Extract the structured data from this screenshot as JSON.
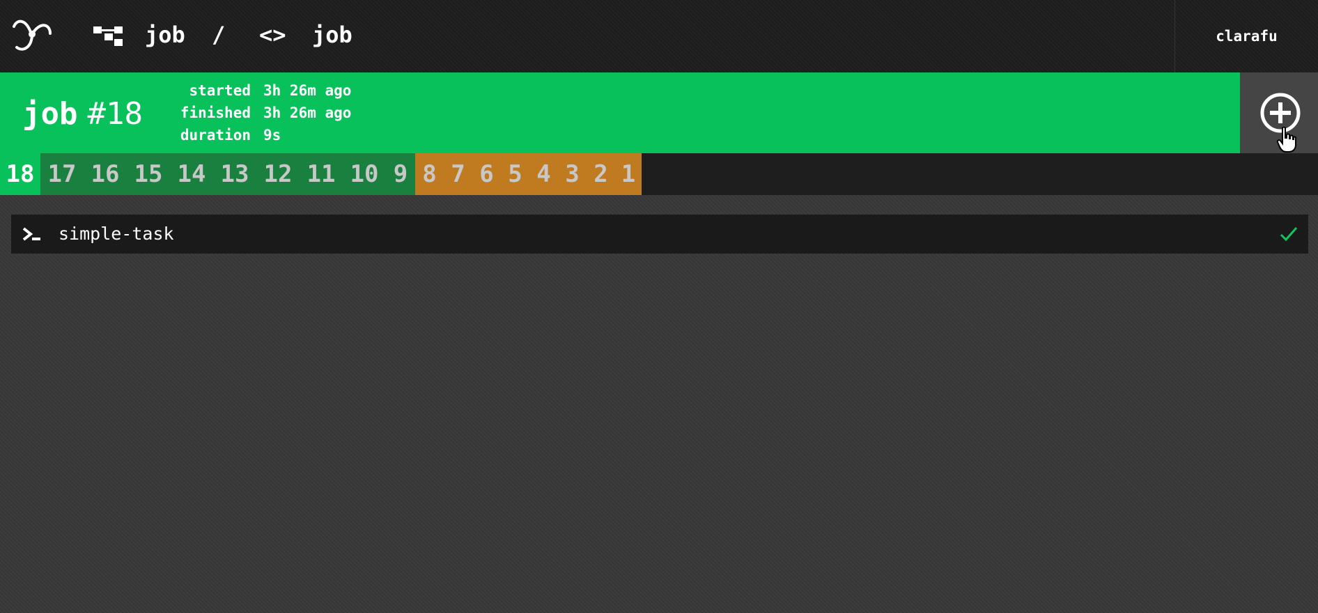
{
  "topbar": {
    "pipeline_name": "job",
    "separator": "/",
    "job_icon_glyph": "<>",
    "job_name": "job",
    "username": "clarafu",
    "logo_icon": "concourse-logo-icon",
    "pipeline_icon": "pipeline-icon"
  },
  "build": {
    "job_name": "job",
    "number": "#18",
    "status": "succeeded",
    "meta": [
      {
        "key": "started",
        "value": "3h 26m ago"
      },
      {
        "key": "finished",
        "value": "3h 26m ago"
      },
      {
        "key": "duration",
        "value": "9s"
      }
    ],
    "trigger_icon": "add-circle-icon"
  },
  "build_tabs": [
    {
      "label": "18",
      "status": "current"
    },
    {
      "label": "17",
      "status": "succeeded"
    },
    {
      "label": "16",
      "status": "succeeded"
    },
    {
      "label": "15",
      "status": "succeeded"
    },
    {
      "label": "14",
      "status": "succeeded"
    },
    {
      "label": "13",
      "status": "succeeded"
    },
    {
      "label": "12",
      "status": "succeeded"
    },
    {
      "label": "11",
      "status": "succeeded"
    },
    {
      "label": "10",
      "status": "succeeded"
    },
    {
      "label": "9",
      "status": "succeeded"
    },
    {
      "label": "8",
      "status": "failed"
    },
    {
      "label": "7",
      "status": "failed"
    },
    {
      "label": "6",
      "status": "failed"
    },
    {
      "label": "5",
      "status": "failed"
    },
    {
      "label": "4",
      "status": "failed"
    },
    {
      "label": "3",
      "status": "failed"
    },
    {
      "label": "2",
      "status": "failed"
    },
    {
      "label": "1",
      "status": "failed"
    }
  ],
  "steps": [
    {
      "name": "simple-task",
      "type_icon": "terminal-icon",
      "status_icon": "checkmark-icon"
    }
  ],
  "colors": {
    "succeeded": "#09c15a",
    "succeeded_tab": "#19803f",
    "failed_tab": "#c07a20",
    "topbar": "#1e1e1e",
    "check": "#11c560"
  }
}
